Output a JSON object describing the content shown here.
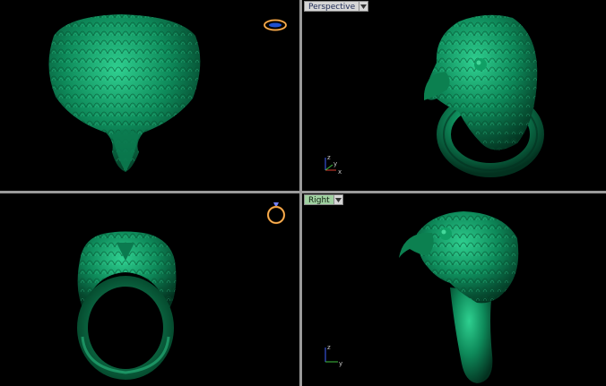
{
  "viewports": {
    "perspective": {
      "label": "Perspective"
    },
    "right": {
      "label": "Right"
    }
  },
  "axes": {
    "x": "x",
    "y": "y",
    "z": "z"
  },
  "colors": {
    "model_green": "#0e8a5a",
    "label_bg": "#d6d6d6",
    "active_label_bg": "#9fd0a0",
    "divider": "#9a9a9a",
    "axis_x": "#e04030",
    "axis_y": "#40c040",
    "axis_z": "#4060ff"
  },
  "icons": [
    "ring-orientation-icon",
    "ring-top-icon",
    "dropdown-arrow-icon",
    "axis-gizmo"
  ]
}
